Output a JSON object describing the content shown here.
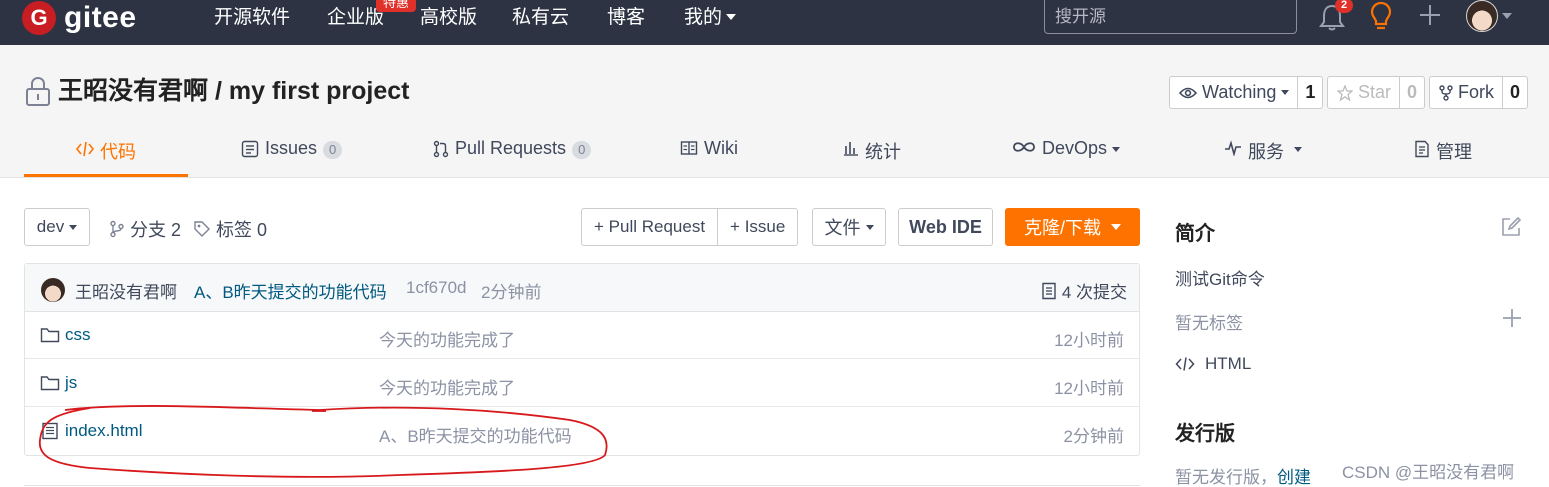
{
  "brand": {
    "name": "gitee",
    "mark": "G"
  },
  "topnav": {
    "items": [
      "开源软件",
      "企业版",
      "高校版",
      "私有云",
      "博客",
      "我的"
    ],
    "hot_badge": "特惠",
    "search_placeholder": "搜开源",
    "notification_count": "2"
  },
  "repo": {
    "owner": "王昭没有君啊",
    "separator": "/",
    "name": "my first project",
    "watch": {
      "label": "Watching",
      "count": "1"
    },
    "star": {
      "label": "Star",
      "count": "0"
    },
    "fork": {
      "label": "Fork",
      "count": "0"
    }
  },
  "tabs": [
    {
      "label": "代码"
    },
    {
      "label": "Issues",
      "badge": "0"
    },
    {
      "label": "Pull Requests",
      "badge": "0"
    },
    {
      "label": "Wiki"
    },
    {
      "label": "统计"
    },
    {
      "label": "DevOps"
    },
    {
      "label": "服务"
    },
    {
      "label": "管理"
    }
  ],
  "toolbar": {
    "branch": "dev",
    "branches": "分支 2",
    "tags": "标签 0",
    "pull_request": "+ Pull Request",
    "issue": "+ Issue",
    "files": "文件",
    "web_ide": "Web IDE",
    "clone": "克隆/下载"
  },
  "commit": {
    "author": "王昭没有君啊",
    "message": "A、B昨天提交的功能代码",
    "hash": "1cf670d",
    "time": "2分钟前",
    "count_label": "4 次提交"
  },
  "files": [
    {
      "name": "css",
      "type": "folder",
      "message": "今天的功能完成了",
      "time": "12小时前"
    },
    {
      "name": "js",
      "type": "folder",
      "message": "今天的功能完成了",
      "time": "12小时前"
    },
    {
      "name": "index.html",
      "type": "file",
      "message": "A、B昨天提交的功能代码",
      "time": "2分钟前"
    }
  ],
  "sidebar": {
    "intro_title": "简介",
    "description": "测试Git命令",
    "no_tags": "暂无标签",
    "language": "HTML",
    "release_title": "发行版",
    "no_release": "暂无发行版，",
    "create_link": "创建"
  },
  "watermark": "CSDN @王昭没有君啊",
  "colors": {
    "accent": "#fe7300",
    "navbar": "#2e3343",
    "brand_red": "#c71d23",
    "link": "#005980",
    "annotation": "#d7191c"
  }
}
